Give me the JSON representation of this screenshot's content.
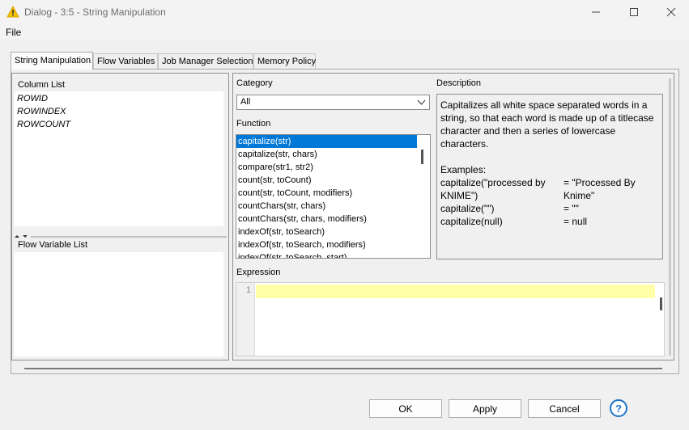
{
  "window": {
    "title": "Dialog - 3:5 - String Manipulation"
  },
  "menu": {
    "file": "File"
  },
  "tabs": [
    "String Manipulation",
    "Flow Variables",
    "Job Manager Selection",
    "Memory Policy"
  ],
  "left": {
    "column_list_title": "Column List",
    "columns": [
      "ROWID",
      "ROWINDEX",
      "ROWCOUNT"
    ],
    "flow_variable_title": "Flow Variable List"
  },
  "category": {
    "label": "Category",
    "value": "All"
  },
  "function": {
    "label": "Function",
    "items": [
      "capitalize(str)",
      "capitalize(str, chars)",
      "compare(str1, str2)",
      "count(str, toCount)",
      "count(str, toCount, modifiers)",
      "countChars(str, chars)",
      "countChars(str, chars, modifiers)",
      "indexOf(str, toSearch)",
      "indexOf(str, toSearch, modifiers)",
      "indexOf(str, toSearch, start)"
    ]
  },
  "description": {
    "label": "Description",
    "text": "Capitalizes all white space separated words in a string, so that each word is made up of a titlecase character and then a series of lowercase characters.",
    "examples_title": "Examples:",
    "examples": [
      {
        "call": "capitalize(\"processed by KNIME\")",
        "result": "= \"Processed By Knime\""
      },
      {
        "call": "capitalize(\"\")",
        "result": "= \"\""
      },
      {
        "call": "capitalize(null)",
        "result": "= null"
      }
    ]
  },
  "expression": {
    "label": "Expression",
    "line_number": "1"
  },
  "buttons": {
    "ok": "OK",
    "apply": "Apply",
    "cancel": "Cancel",
    "help": "?"
  }
}
